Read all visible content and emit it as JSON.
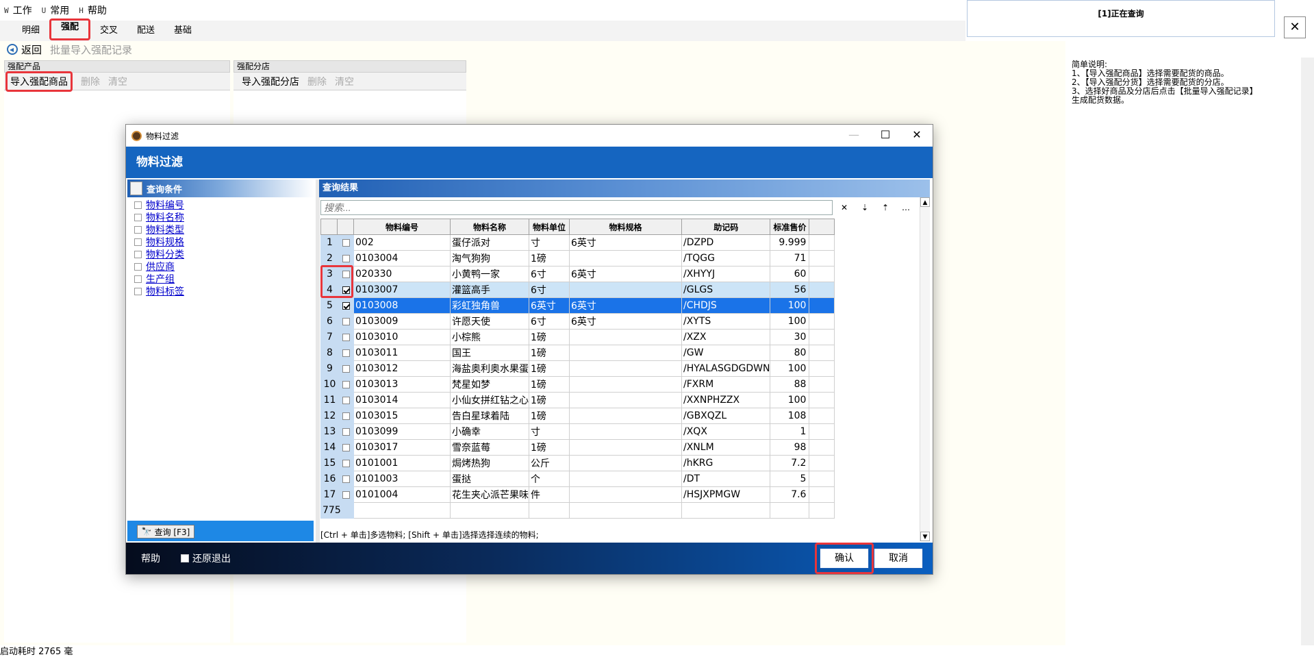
{
  "menu": {
    "items": [
      {
        "key": "W",
        "label": "工作"
      },
      {
        "key": "U",
        "label": "常用"
      },
      {
        "key": "H",
        "label": "帮助"
      }
    ]
  },
  "tabs": [
    "明细",
    "强配",
    "交叉",
    "配送",
    "基础"
  ],
  "active_tab": "强配",
  "status_box": {
    "text": "[1]正在查询"
  },
  "close_label": "✕",
  "action_bar": {
    "back": "返回",
    "batch_import": "批量导入强配记录"
  },
  "panel_product": {
    "title": "强配产品",
    "import": "导入强配商品",
    "delete": "删除",
    "clear": "清空"
  },
  "panel_store": {
    "title": "强配分店",
    "import": "导入强配分店",
    "delete": "删除",
    "clear": "清空"
  },
  "notes": [
    "简单说明:",
    "1、【导入强配商品】选择需要配货的商品。",
    "2、【导入强配分货】选择需要配货的分店。",
    "3、选择好商品及分店后点击【批量导入强配记录】",
    "生成配货数据。"
  ],
  "footer_status": "启动耗时 2765 毫",
  "dialog": {
    "window_title": "物料过滤",
    "banner": "物料过滤",
    "win_min": "—",
    "win_max": "☐",
    "win_close": "✕",
    "conditions": {
      "title": "查询条件",
      "items": [
        "物料编号",
        "物料名称",
        "物料类型",
        "物料规格",
        "物料分类",
        "供应商",
        "生产组",
        "物料标签"
      ],
      "query_button": "查询 [F3]"
    },
    "results": {
      "title": "查询结果",
      "search_placeholder": "搜索...",
      "tools": [
        "✕",
        "⇣",
        "⇡",
        "…"
      ],
      "columns": [
        "",
        "物料编号",
        "物料名称",
        "物料单位",
        "物料规格",
        "助记码",
        "标准售价"
      ],
      "rows": [
        {
          "n": "1",
          "checked": false,
          "code": "002",
          "name": "蛋仔派对",
          "unit": "寸",
          "spec": "6英寸",
          "mnemonic": "/DZPD",
          "price": "9.999"
        },
        {
          "n": "2",
          "checked": false,
          "code": "0103004",
          "name": "淘气狗狗",
          "unit": "1磅",
          "spec": "",
          "mnemonic": "/TQGG",
          "price": "71"
        },
        {
          "n": "3",
          "checked": false,
          "code": "020330",
          "name": "小黄鸭一家",
          "unit": "6寸",
          "spec": "6英寸",
          "mnemonic": "/XHYYJ",
          "price": "60"
        },
        {
          "n": "4",
          "checked": true,
          "code": "0103007",
          "name": "灌篮高手",
          "unit": "6寸",
          "spec": "",
          "mnemonic": "/GLGS",
          "price": "56"
        },
        {
          "n": "5",
          "checked": true,
          "code": "0103008",
          "name": "彩虹独角兽",
          "unit": "6英寸",
          "spec": "6英寸",
          "mnemonic": "/CHDJS",
          "price": "100"
        },
        {
          "n": "6",
          "checked": false,
          "code": "0103009",
          "name": "许愿天使",
          "unit": "6寸",
          "spec": "6英寸",
          "mnemonic": "/XYTS",
          "price": "100"
        },
        {
          "n": "7",
          "checked": false,
          "code": "0103010",
          "name": "小棕熊",
          "unit": "1磅",
          "spec": "",
          "mnemonic": "/XZX",
          "price": "30"
        },
        {
          "n": "8",
          "checked": false,
          "code": "0103011",
          "name": "国王",
          "unit": "1磅",
          "spec": "",
          "mnemonic": "/GW",
          "price": "80"
        },
        {
          "n": "9",
          "checked": false,
          "code": "0103012",
          "name": "海盐奥利奥水果蛋",
          "unit": "1磅",
          "spec": "",
          "mnemonic": "/HYALASGDGDWN",
          "price": "100"
        },
        {
          "n": "10",
          "checked": false,
          "code": "0103013",
          "name": "梵星如梦",
          "unit": "1磅",
          "spec": "",
          "mnemonic": "/FXRM",
          "price": "88"
        },
        {
          "n": "11",
          "checked": false,
          "code": "0103014",
          "name": "小仙女拼红钻之心",
          "unit": "1磅",
          "spec": "",
          "mnemonic": "/XXNPHZZX",
          "price": "100"
        },
        {
          "n": "12",
          "checked": false,
          "code": "0103015",
          "name": "告白星球着陆",
          "unit": "1磅",
          "spec": "",
          "mnemonic": "/GBXQZL",
          "price": "108"
        },
        {
          "n": "13",
          "checked": false,
          "code": "0103099",
          "name": "小确幸",
          "unit": "寸",
          "spec": "",
          "mnemonic": "/XQX",
          "price": "1"
        },
        {
          "n": "14",
          "checked": false,
          "code": "0103017",
          "name": "雪奈蓝莓",
          "unit": "1磅",
          "spec": "",
          "mnemonic": "/XNLM",
          "price": "98"
        },
        {
          "n": "15",
          "checked": false,
          "code": "0101001",
          "name": "焗烤热狗",
          "unit": "公斤",
          "spec": "",
          "mnemonic": "/hKRG",
          "price": "7.2"
        },
        {
          "n": "16",
          "checked": false,
          "code": "0101003",
          "name": "蛋挞",
          "unit": "个",
          "spec": "",
          "mnemonic": "/DT",
          "price": "5"
        },
        {
          "n": "17",
          "checked": false,
          "code": "0101004",
          "name": "花生夹心派芒果味",
          "unit": "件",
          "spec": "",
          "mnemonic": "/HSJXPMGW",
          "price": "7.6"
        }
      ],
      "total": "775",
      "hint": "[Ctrl + 单击]多选物料; [Shift + 单击]选择选择连续的物料;"
    },
    "footer": {
      "help": "帮助",
      "restore_exit": "还原退出",
      "confirm": "确认",
      "cancel": "取消"
    }
  }
}
